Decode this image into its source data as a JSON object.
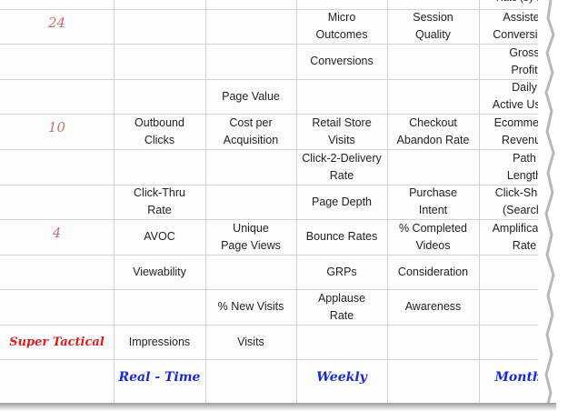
{
  "row_numbers": {
    "r24": "24",
    "r10": "10",
    "r4": "4"
  },
  "top_partial_text": "Rate (by FY)",
  "rows": [
    {
      "real_time": "",
      "c2": "",
      "weekly": "Micro\nOutcomes",
      "c4": "Session\nQuality",
      "monthly": "Assisted\nConversions"
    },
    {
      "real_time": "",
      "c2": "",
      "weekly": "Conversions",
      "c4": "",
      "monthly": "Gross\nProfit"
    },
    {
      "real_time": "",
      "c2": "Page Value",
      "weekly": "",
      "c4": "",
      "monthly": "Daily\nActive Users"
    },
    {
      "real_time": "Outbound\nClicks",
      "c2": "Cost per\nAcquisition",
      "weekly": "Retail Store\nVisits",
      "c4": "Checkout\nAbandon Rate",
      "monthly": "Ecommerce\nRevenue"
    },
    {
      "real_time": "",
      "c2": "",
      "weekly": "Click-2-Delivery\nRate",
      "c4": "",
      "monthly": "Path\nLength"
    },
    {
      "real_time": "Click-Thru\nRate",
      "c2": "",
      "weekly": "Page Depth",
      "c4": "Purchase\nIntent",
      "monthly": "Click-Share\n(Search)"
    },
    {
      "real_time": "AVOC",
      "c2": "Unique\nPage Views",
      "weekly": "Bounce Rates",
      "c4": "% Completed\nVideos",
      "monthly": "Amplification\nRate"
    },
    {
      "real_time": "Viewability",
      "c2": "",
      "weekly": "GRPs",
      "c4": "Consideration",
      "monthly": ""
    },
    {
      "real_time": "",
      "c2": "% New Visits",
      "weekly": "Applause\nRate",
      "c4": "Awareness",
      "monthly": ""
    },
    {
      "real_time": "Impressions",
      "c2": "Visits",
      "weekly": "",
      "c4": "",
      "monthly": ""
    }
  ],
  "row_label_super_tactical": "Super Tactical",
  "column_headers": {
    "real_time": "Real - Time",
    "weekly": "Weekly",
    "monthly": "Monthly"
  },
  "colors": {
    "row_number": "#c9706e",
    "tactical": "#e01a1a",
    "column_header": "#1a2bd6",
    "grid": "#cfd3d6"
  }
}
